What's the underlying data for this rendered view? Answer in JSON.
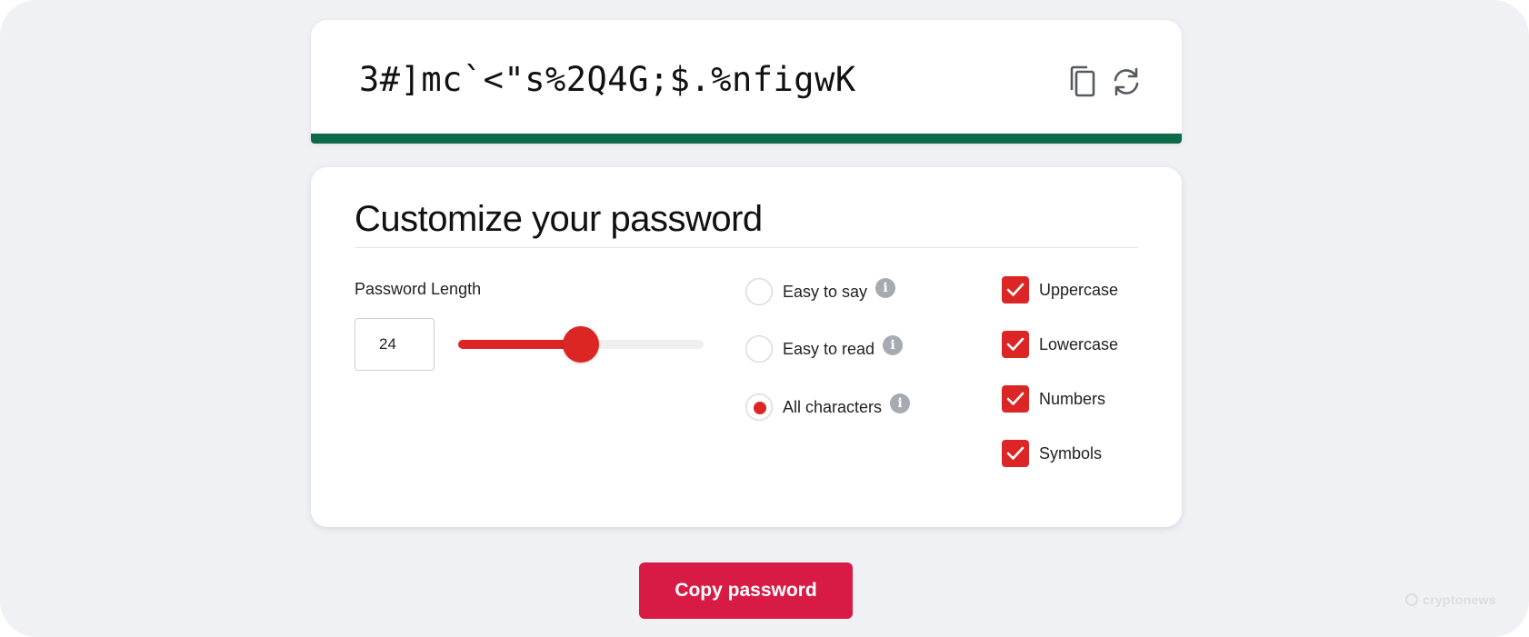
{
  "password": {
    "value": "3#]mc`<\"s%2Q4G;$.%nfigwK",
    "strength_color": "#0d6b4a",
    "copy_icon": "copy-icon",
    "refresh_icon": "refresh-icon"
  },
  "customize": {
    "title": "Customize your password",
    "length_label": "Password Length",
    "length_value": "24",
    "slider_fraction": 0.5,
    "accent_color": "#dc2626",
    "modes": [
      {
        "label": "Easy to say",
        "checked": false
      },
      {
        "label": "Easy to read",
        "checked": false
      },
      {
        "label": "All characters",
        "checked": true
      }
    ],
    "options": [
      {
        "label": "Uppercase",
        "checked": true
      },
      {
        "label": "Lowercase",
        "checked": true
      },
      {
        "label": "Numbers",
        "checked": true
      },
      {
        "label": "Symbols",
        "checked": true
      }
    ]
  },
  "copy_button_label": "Copy password",
  "watermark": "cryptonews"
}
